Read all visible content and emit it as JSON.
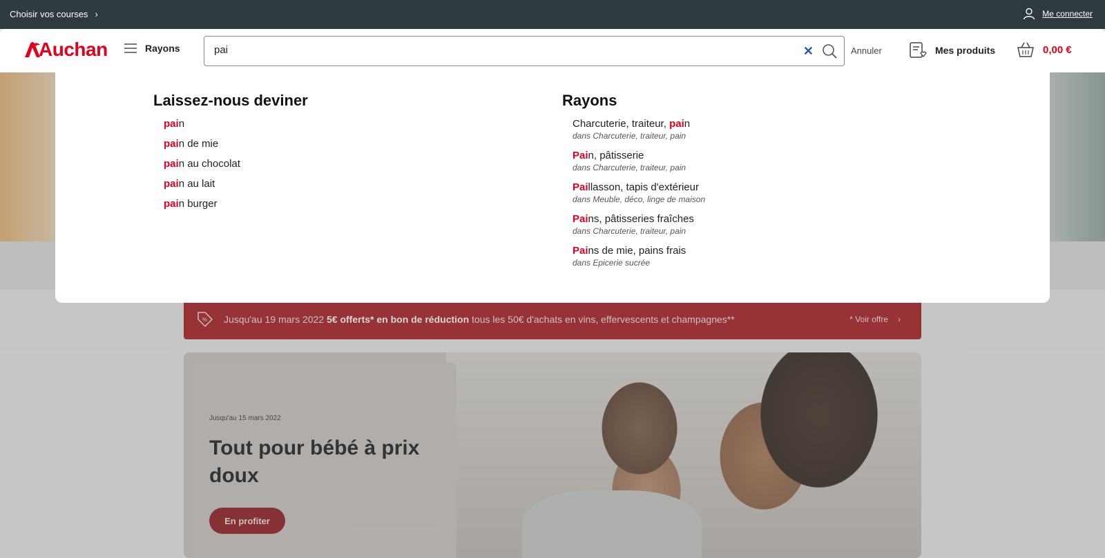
{
  "topbar": {
    "choose_label": "Choisir vos courses",
    "login_label": "Me connecter"
  },
  "header": {
    "logo": "Auchan",
    "rayons_label": "Rayons",
    "search_value": "pai",
    "cancel_label": "Annuler",
    "my_products_label": "Mes produits",
    "cart_total": "0,00 €"
  },
  "dropdown": {
    "guess_heading": "Laissez-nous deviner",
    "guesses": [
      {
        "hl": "pai",
        "rest": "n"
      },
      {
        "hl": "pai",
        "rest": "n de mie"
      },
      {
        "hl": "pai",
        "rest": "n au chocolat"
      },
      {
        "hl": "pai",
        "rest": "n au lait"
      },
      {
        "hl": "pai",
        "rest": "n burger"
      }
    ],
    "rayons_heading": "Rayons",
    "rayons": [
      {
        "pre": "Charcuterie, traiteur, ",
        "hl": "pai",
        "rest": "n",
        "sub": "dans Charcuterie, traiteur, pain"
      },
      {
        "pre": "",
        "hl": "Pai",
        "rest": "n, pâtisserie",
        "sub": "dans Charcuterie, traiteur, pain"
      },
      {
        "pre": "",
        "hl": "Pai",
        "rest": "llasson, tapis d'extérieur",
        "sub": "dans Meuble, déco, linge de maison"
      },
      {
        "pre": "",
        "hl": "Pai",
        "rest": "ns, pâtisseries fraîches",
        "sub": "dans Charcuterie, traiteur, pain"
      },
      {
        "pre": "",
        "hl": "Pai",
        "rest": "ns de mie, pains frais",
        "sub": "dans Epicerie sucrée"
      }
    ]
  },
  "promo": {
    "text_prefix": "Jusqu'au 19 mars 2022 ",
    "text_bold": "5€ offerts* en bon de réduction",
    "text_suffix": " tous les 50€ d'achats en vins, effervescents et champagnes**",
    "offer_label": "* Voir offre"
  },
  "card": {
    "date": "Jusqu'au 15 mars 2022",
    "title": "Tout pour bébé à prix doux",
    "cta_label": "En profiter"
  },
  "colors": {
    "brand_red": "#e2001a",
    "topbar": "#2e3a3f",
    "promo_bg": "#a5161c"
  }
}
